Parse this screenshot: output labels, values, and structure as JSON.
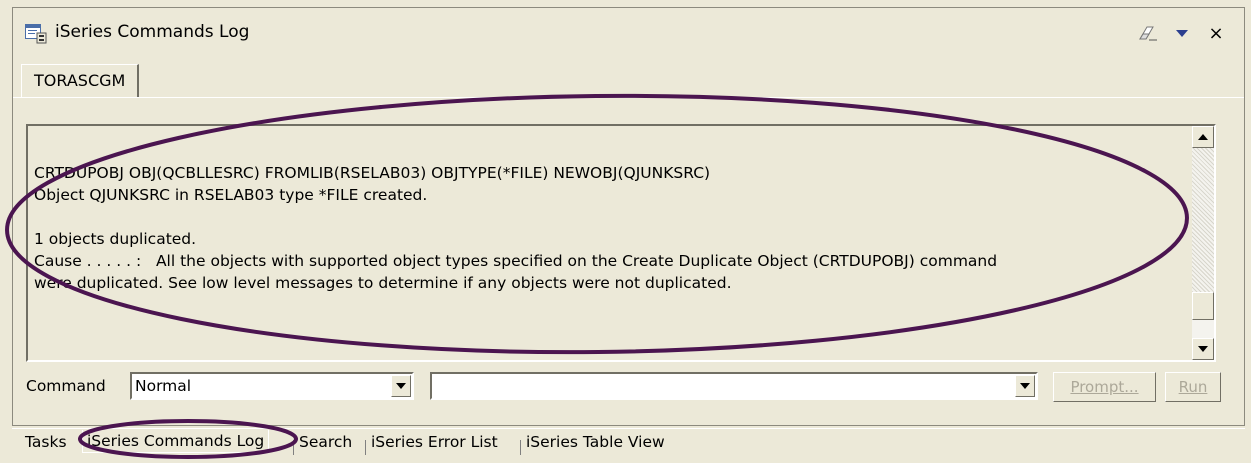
{
  "view": {
    "title": "iSeries Commands Log",
    "icons": {
      "view_icon": "commands-log-icon",
      "clear": "eraser-icon",
      "menu": "view-menu-icon",
      "close": "close-icon"
    },
    "close_glyph": "×"
  },
  "tabs": [
    {
      "label": "TORASCGM"
    }
  ],
  "log": {
    "lines": [
      "CRTDUPOBJ OBJ(QCBLLESRC) FROMLIB(RSELAB03) OBJTYPE(*FILE) NEWOBJ(QJUNKSRC)",
      "Object QJUNKSRC in RSELAB03 type *FILE created.",
      "",
      "1 objects duplicated.",
      "Cause . . . . . :   All the objects with supported object types specified on the Create Duplicate Object (CRTDUPOBJ) command",
      "were duplicated. See low level messages to determine if any objects were not duplicated."
    ]
  },
  "command_row": {
    "label": "Command",
    "mode_value": "Normal",
    "command_value": "",
    "prompt_label": "Prompt...",
    "run_label": "Run"
  },
  "bottom_tabs": [
    {
      "label": "Tasks"
    },
    {
      "label": "iSeries Commands Log"
    },
    {
      "label": "Search"
    },
    {
      "label": "iSeries Error List"
    },
    {
      "label": "iSeries Table View"
    }
  ],
  "colors": {
    "annotation_oval": "#4b1550",
    "background": "#ece9d8",
    "disabled_text": "#aca899"
  }
}
